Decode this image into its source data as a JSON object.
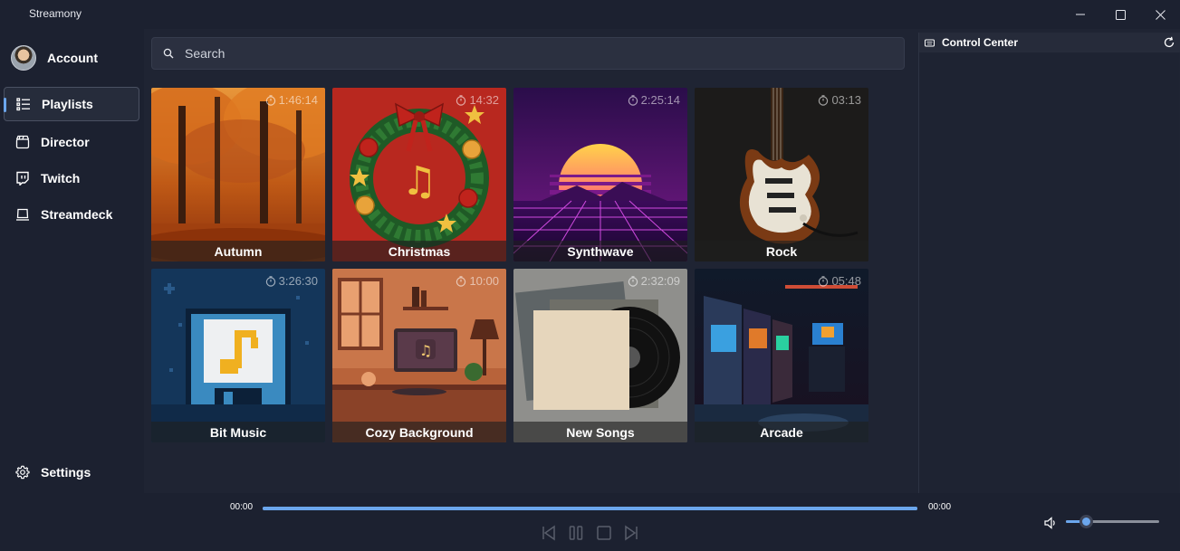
{
  "window": {
    "title": "Streamony"
  },
  "sidebar": {
    "account_label": "Account",
    "items": [
      {
        "label": "Playlists",
        "icon": "list-icon",
        "active": true
      },
      {
        "label": "Director",
        "icon": "clapperboard-icon",
        "active": false
      },
      {
        "label": "Twitch",
        "icon": "twitch-icon",
        "active": false
      },
      {
        "label": "Streamdeck",
        "icon": "streamdeck-icon",
        "active": false
      }
    ],
    "settings_label": "Settings"
  },
  "search": {
    "placeholder": "Search",
    "value": ""
  },
  "playlists": [
    {
      "name": "Autumn",
      "duration": "1:46:14"
    },
    {
      "name": "Christmas",
      "duration": "14:32"
    },
    {
      "name": "Synthwave",
      "duration": "2:25:14"
    },
    {
      "name": "Rock",
      "duration": "03:13"
    },
    {
      "name": "Bit Music",
      "duration": "3:26:30"
    },
    {
      "name": "Cozy Background",
      "duration": "10:00"
    },
    {
      "name": "New Songs",
      "duration": "2:32:09"
    },
    {
      "name": "Arcade",
      "duration": "05:48"
    }
  ],
  "control_center": {
    "title": "Control Center"
  },
  "player": {
    "elapsed": "00:00",
    "total": "00:00",
    "progress": 1.0,
    "volume": 0.22
  },
  "colors": {
    "accent": "#6ba6ec",
    "background": "#1f2433",
    "sidebar": "#1c2130"
  }
}
